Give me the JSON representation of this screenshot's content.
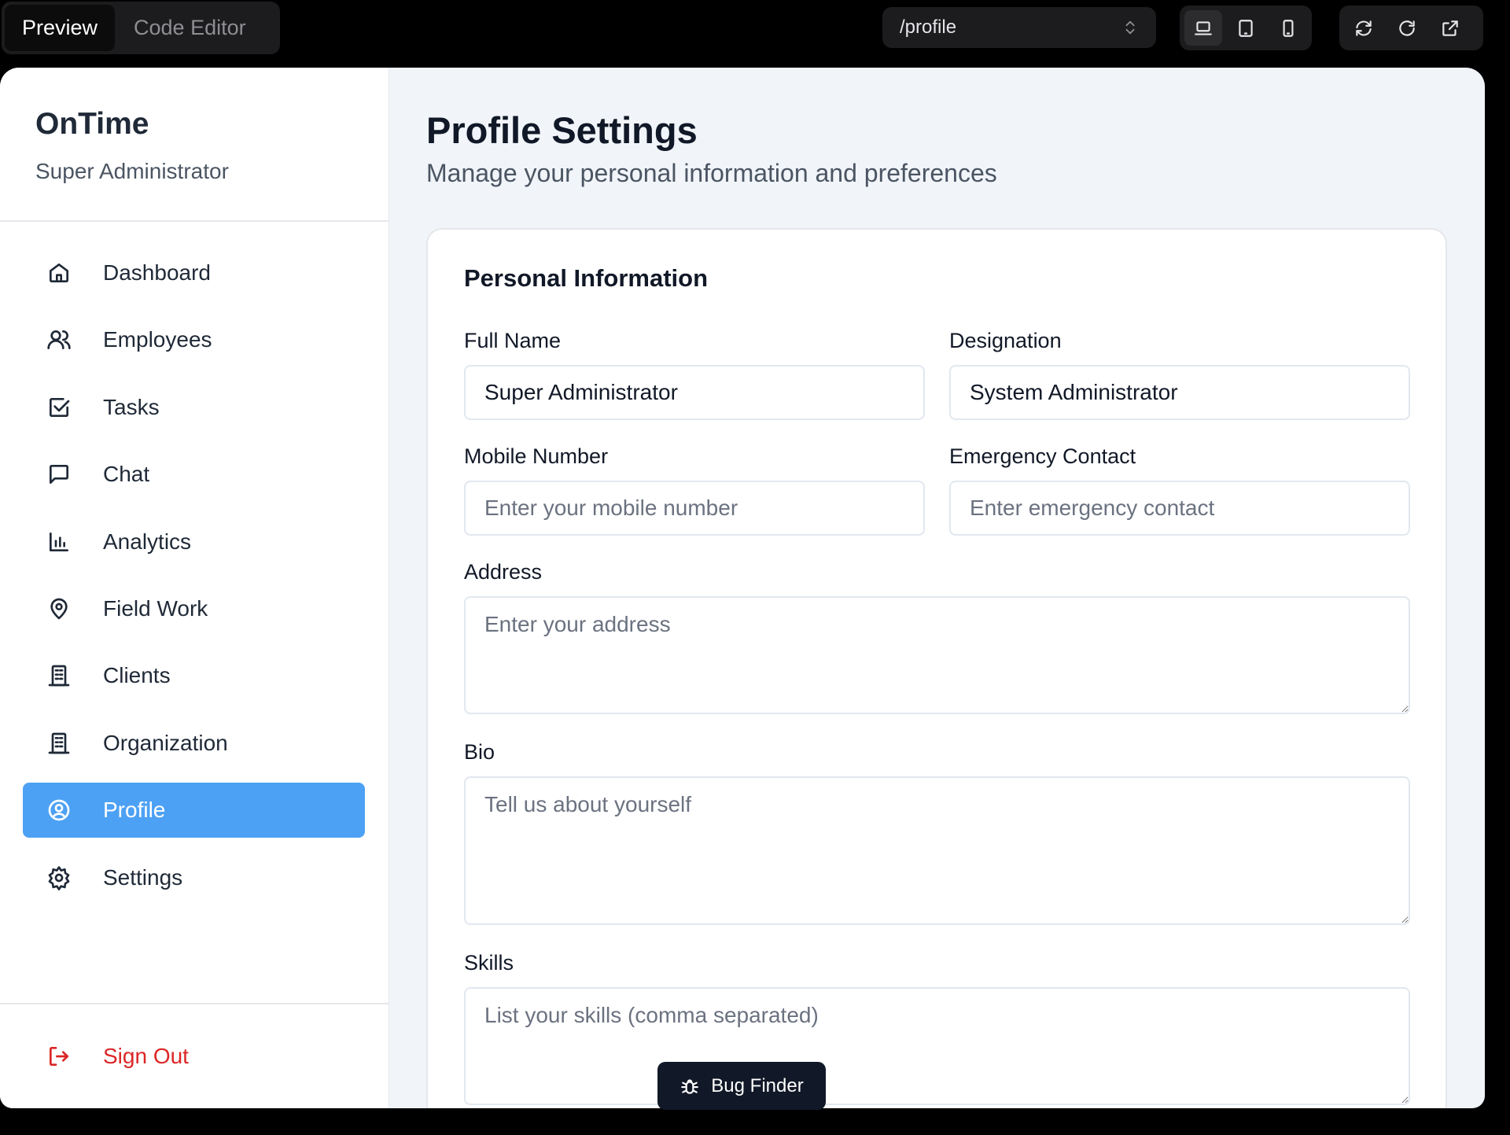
{
  "toolbar": {
    "tabs": [
      {
        "label": "Preview",
        "active": true
      },
      {
        "label": "Code Editor",
        "active": false
      }
    ],
    "url": "/profile",
    "url_icon": "chevron-up-down-icon",
    "device_icons": [
      "laptop-icon",
      "tablet-icon",
      "phone-icon"
    ],
    "action_icons": [
      "sync-icon",
      "refresh-icon",
      "external-link-icon"
    ]
  },
  "sidebar": {
    "brand": "OnTime",
    "role": "Super Administrator",
    "items": [
      {
        "label": "Dashboard",
        "icon": "home-icon"
      },
      {
        "label": "Employees",
        "icon": "users-icon"
      },
      {
        "label": "Tasks",
        "icon": "check-square-icon"
      },
      {
        "label": "Chat",
        "icon": "message-icon"
      },
      {
        "label": "Analytics",
        "icon": "bar-chart-icon"
      },
      {
        "label": "Field Work",
        "icon": "map-pin-icon"
      },
      {
        "label": "Clients",
        "icon": "building-icon"
      },
      {
        "label": "Organization",
        "icon": "building-icon"
      },
      {
        "label": "Profile",
        "icon": "user-circle-icon",
        "active": true
      },
      {
        "label": "Settings",
        "icon": "gear-icon"
      }
    ],
    "sign_out": "Sign Out",
    "accent_color": "#4da1f4",
    "danger_color": "#dc2626"
  },
  "page": {
    "title": "Profile Settings",
    "subtitle": "Manage your personal information and preferences"
  },
  "personal_info": {
    "title": "Personal Information",
    "full_name": {
      "label": "Full Name",
      "value": "Super Administrator"
    },
    "designation": {
      "label": "Designation",
      "value": "System Administrator"
    },
    "mobile": {
      "label": "Mobile Number",
      "placeholder": "Enter your mobile number"
    },
    "emergency": {
      "label": "Emergency Contact",
      "placeholder": "Enter emergency contact"
    },
    "address": {
      "label": "Address",
      "placeholder": "Enter your address"
    },
    "bio": {
      "label": "Bio",
      "placeholder": "Tell us about yourself"
    },
    "skills": {
      "label": "Skills",
      "placeholder": "List your skills (comma separated)"
    }
  },
  "bug_finder": {
    "label": "Bug Finder",
    "icon": "bug-icon"
  }
}
